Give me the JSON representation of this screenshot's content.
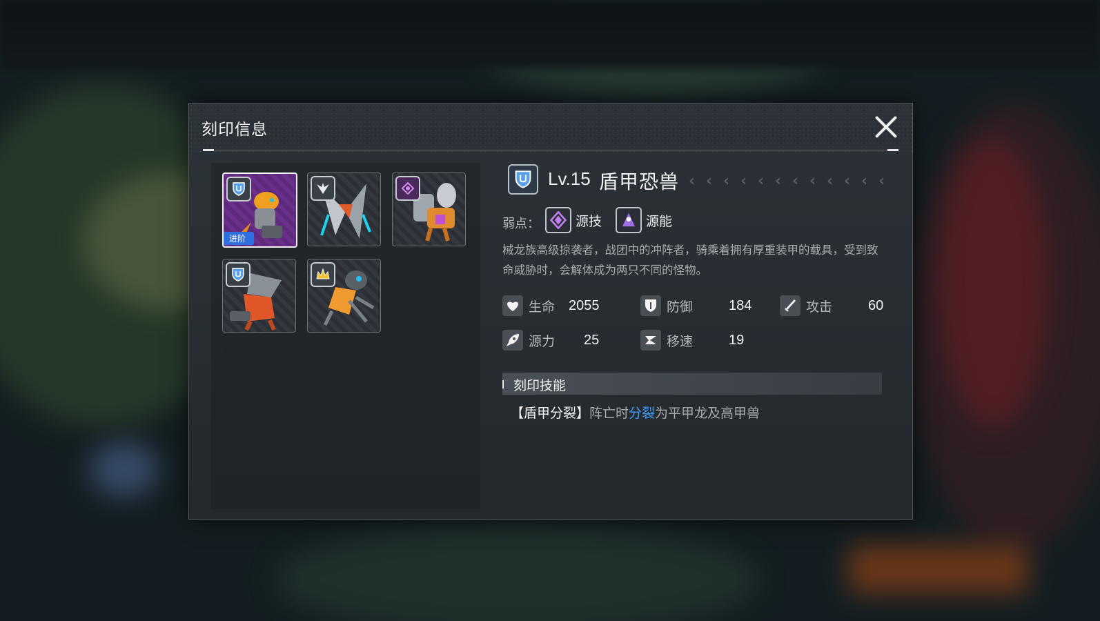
{
  "modal": {
    "title": "刻印信息"
  },
  "cards": [
    {
      "type_icon": "shield-type-icon",
      "selected": true,
      "badge": "进阶"
    },
    {
      "type_icon": "wing-type-icon",
      "selected": false
    },
    {
      "type_icon": "arcane-type-icon",
      "selected": false
    },
    {
      "type_icon": "shield-type-icon",
      "selected": false
    },
    {
      "type_icon": "crown-type-icon",
      "selected": false
    }
  ],
  "monster": {
    "level": "Lv.15",
    "name": "盾甲恐兽",
    "weakness_label": "弱点：",
    "weaknesses": [
      {
        "icon": "source-skill-icon",
        "label": "源技"
      },
      {
        "icon": "source-energy-icon",
        "label": "源能"
      }
    ],
    "description": "械龙族高级掠袭者，战团中的冲阵者，骑乘着拥有厚重装甲的载具，受到致命威胁时，会解体成为两只不同的怪物。"
  },
  "stats": {
    "hp": {
      "label": "生命",
      "value": "2055"
    },
    "defense": {
      "label": "防御",
      "value": "184"
    },
    "attack": {
      "label": "攻击",
      "value": "60"
    },
    "source_power": {
      "label": "源力",
      "value": "25"
    },
    "move_speed": {
      "label": "移速",
      "value": "19"
    }
  },
  "skill": {
    "section_title": "刻印技能",
    "name": "【盾甲分裂】",
    "text_before": "阵亡时",
    "highlight": "分裂",
    "text_after": "为平甲龙及高甲兽"
  },
  "colors": {
    "highlight": "#3d9bff",
    "badge": "#2f6fe0",
    "selected_card_bg": "#6a2f8a"
  }
}
